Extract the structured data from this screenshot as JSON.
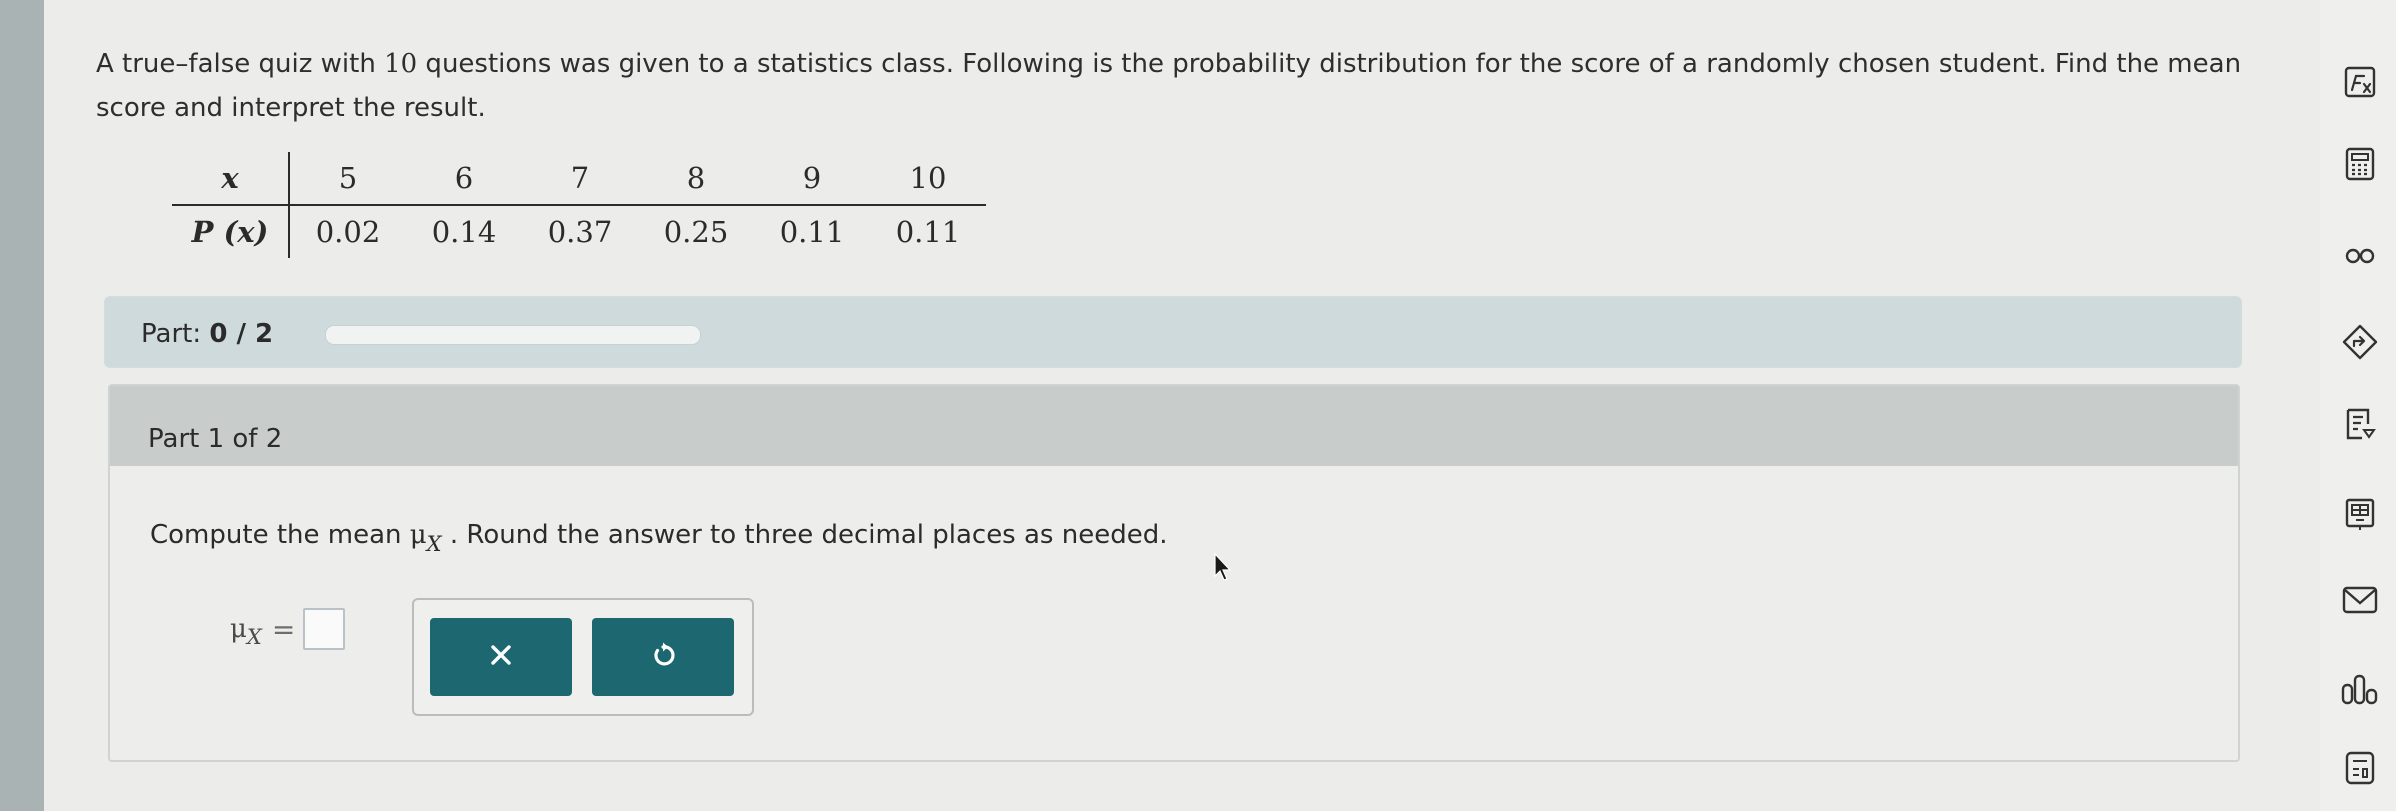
{
  "question": {
    "text_before_num": "A true–false quiz with ",
    "num": "10",
    "text_after_num": " questions was given to a statistics class. Following is the probability distribution for the score of a randomly chosen student. Find the mean score and interpret the result."
  },
  "table": {
    "row_x_label": "x",
    "row_p_label": "P (x)",
    "x_values": [
      "5",
      "6",
      "7",
      "8",
      "9",
      "10"
    ],
    "p_values": [
      "0.02",
      "0.14",
      "0.37",
      "0.25",
      "0.11",
      "0.11"
    ]
  },
  "part_progress": {
    "label": "Part:",
    "value": "0 / 2",
    "completed_fraction": 0
  },
  "part1": {
    "title": "Part 1 of 2",
    "prompt_before": "Compute the mean ",
    "mu": "μ",
    "sub": "X",
    "prompt_after": " . Round the answer to three decimal places as needed.",
    "answer_mu": "μ",
    "answer_sub": "X",
    "answer_eq": "=",
    "answer_value": ""
  },
  "buttons": {
    "clear_symbol": "×",
    "undo_symbol": "↺"
  },
  "toolbar": {
    "icons": [
      "formula-sheet-icon",
      "calculator-icon",
      "infinity-icon",
      "hint-arrow-icon",
      "ebook-icon",
      "data-table-icon",
      "mail-icon",
      "chart-icon",
      "tools-icon"
    ]
  },
  "colors": {
    "accent": "#1d6870",
    "part_bar": "#cfdadc",
    "card_header": "#c8cdcc"
  }
}
